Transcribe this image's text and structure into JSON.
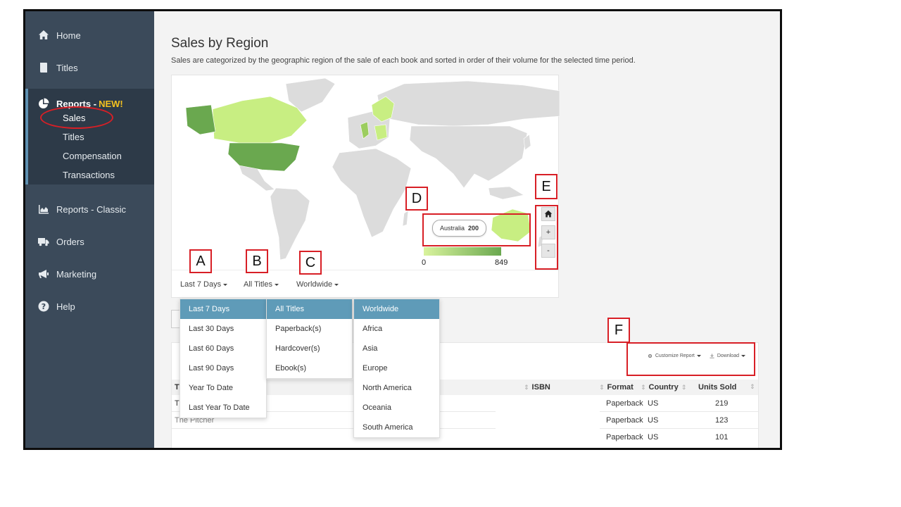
{
  "sidebar": {
    "items": [
      {
        "label": "Home",
        "icon": "home-icon"
      },
      {
        "label": "Titles",
        "icon": "book-icon"
      },
      {
        "label": "Reports - Classic",
        "icon": "area-chart-icon"
      },
      {
        "label": "Orders",
        "icon": "truck-icon"
      },
      {
        "label": "Marketing",
        "icon": "megaphone-icon"
      },
      {
        "label": "Help",
        "icon": "question-icon"
      }
    ],
    "reports_new": {
      "label": "Reports - ",
      "badge": "NEW!",
      "icon": "pie-chart-icon",
      "sub_items": [
        "Sales",
        "Titles",
        "Compensation",
        "Transactions"
      ],
      "active": "Sales"
    }
  },
  "main": {
    "title": "Sales by Region",
    "description": "Sales are categorized by the geographic region of the sale of each book and sorted in order of their volume for the selected time period."
  },
  "map": {
    "tooltip": {
      "region": "Australia",
      "value": "200"
    },
    "legend": {
      "min": "0",
      "max": "849"
    },
    "zoom": {
      "home_icon": "home-icon",
      "zoom_in": "+",
      "zoom_out": "-"
    },
    "colors": {
      "high": "#6aa84f",
      "mid": "#9ccd5f",
      "low": "#c8ee82",
      "none": "#dcdcdc"
    }
  },
  "filters": {
    "period": "Last 7 Days",
    "titles": "All Titles",
    "region": "Worldwide"
  },
  "dropdowns": {
    "period": [
      "Last 7 Days",
      "Last 30 Days",
      "Last 60 Days",
      "Last 90 Days",
      "Year To Date",
      "Last Year To Date"
    ],
    "titles": [
      "All Titles",
      "Paperback(s)",
      "Hardcover(s)",
      "Ebook(s)"
    ],
    "regions": [
      "Worldwide",
      "Africa",
      "Asia",
      "Europe",
      "North America",
      "Oceania",
      "South America"
    ]
  },
  "table": {
    "tools": {
      "customize": "Customize Report",
      "download": "Download"
    },
    "headers": {
      "title": "Ti",
      "isbn": "ISBN",
      "format": "Format",
      "country": "Country",
      "units": "Units Sold"
    },
    "rows": [
      {
        "title": "Th",
        "format": "Paperback",
        "country": "US",
        "units": "219"
      },
      {
        "title": "The Pitcher",
        "format": "Paperback",
        "country": "US",
        "units": "123"
      },
      {
        "title": "",
        "format": "Paperback",
        "country": "US",
        "units": "101"
      }
    ]
  },
  "annotations": {
    "A": "A",
    "B": "B",
    "C": "C",
    "D": "D",
    "E": "E",
    "F": "F"
  }
}
